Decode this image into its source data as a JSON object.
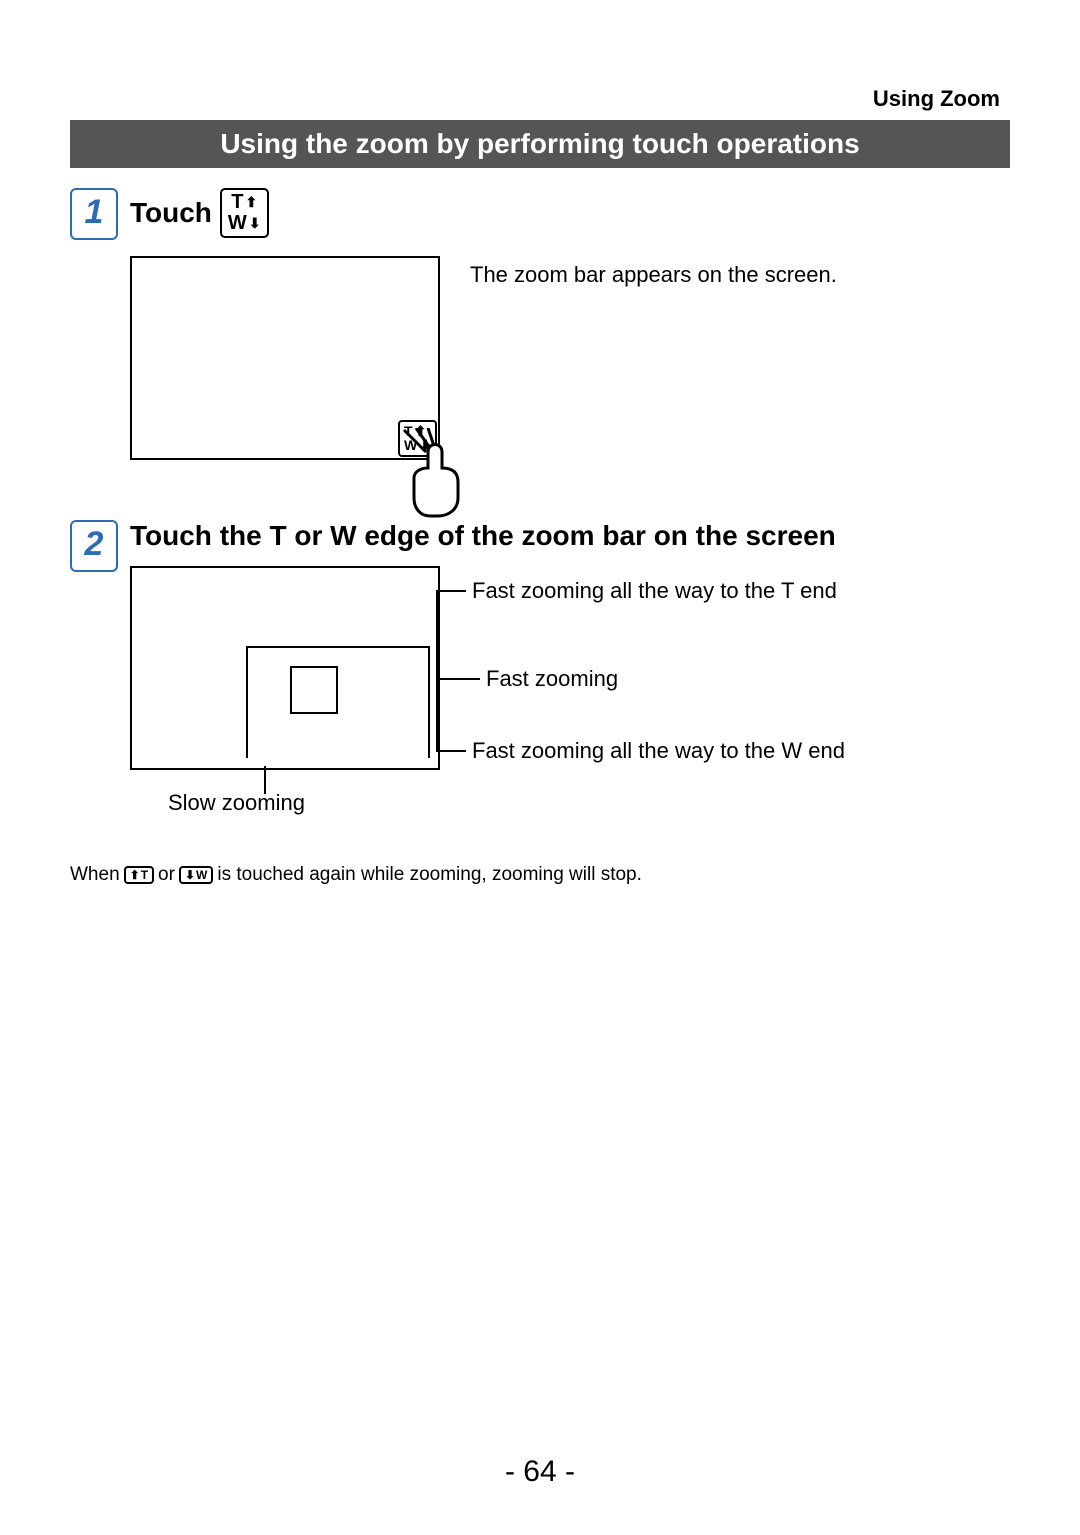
{
  "header": {
    "section": "Using Zoom"
  },
  "banner": {
    "title": "Using the zoom by performing touch operations"
  },
  "steps": [
    {
      "number": "1",
      "title_prefix": "Touch",
      "icon": {
        "top_letter": "T",
        "bottom_letter": "W"
      },
      "description": "The zoom bar appears on the screen."
    },
    {
      "number": "2",
      "title": "Touch the T or W edge of the zoom bar on the screen",
      "labels": {
        "fast_t": "Fast zooming all the way to the T end",
        "fast": "Fast zooming",
        "fast_w": "Fast zooming all the way to the W end",
        "slow": "Slow zooming"
      }
    }
  ],
  "note": {
    "prefix": "When",
    "or": "or",
    "suffix": "is touched again while zooming, zooming will stop.",
    "icon_t": {
      "arrows": "⬆",
      "letter": "T"
    },
    "icon_w": {
      "arrows": "⬇",
      "letter": "W"
    }
  },
  "page_number": "- 64 -"
}
